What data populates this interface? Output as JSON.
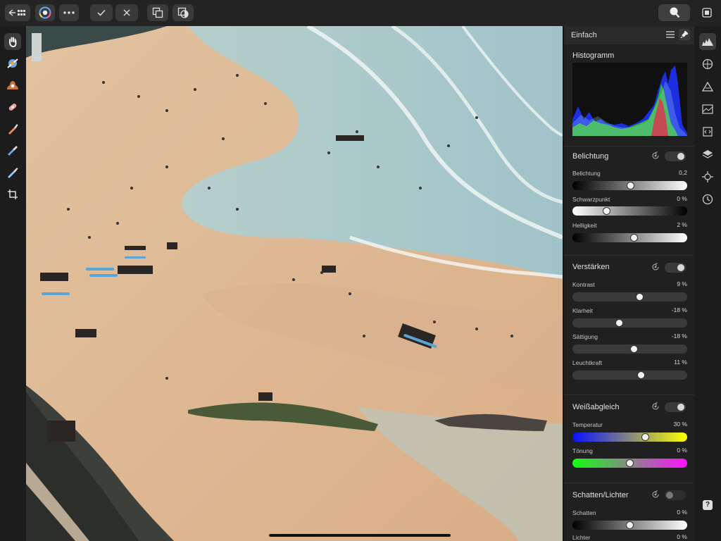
{
  "toolbar": {
    "back_icon": "back-grid-icon",
    "persona_icon": "develop-persona-icon",
    "more_icon": "more-icon",
    "apply_icon": "checkmark-icon",
    "cancel_icon": "close-icon",
    "before_after_icon": "before-after-icon",
    "split_icon": "split-view-icon",
    "zoom_icon": "navigator-zoom-icon",
    "overlay_icon": "overlay-icon"
  },
  "tools": [
    "hand-icon",
    "white-balance-icon",
    "red-eye-icon",
    "blemish-icon",
    "brush-icon",
    "clone-icon",
    "overlay-brush-icon",
    "crop-icon"
  ],
  "panel": {
    "title": "Einfach",
    "histogram_title": "Histogramm",
    "sections": [
      {
        "title": "Belichtung",
        "enabled": true,
        "sliders": [
          {
            "label": "Belichtung",
            "value": "0,2",
            "pos": 0.51,
            "gradient": "dark-light"
          },
          {
            "label": "Schwarzpunkt",
            "value": "0 %",
            "pos": 0.3,
            "gradient": "light-dark"
          },
          {
            "label": "Helligkeit",
            "value": "2 %",
            "pos": 0.54,
            "gradient": "dark-light"
          }
        ]
      },
      {
        "title": "Verstärken",
        "enabled": true,
        "sliders": [
          {
            "label": "Kontrast",
            "value": "9 %",
            "pos": 0.59,
            "gradient": "flat"
          },
          {
            "label": "Klarheit",
            "value": "-18 %",
            "pos": 0.41,
            "gradient": "flat"
          },
          {
            "label": "Sättigung",
            "value": "-18 %",
            "pos": 0.54,
            "gradient": "flat"
          },
          {
            "label": "Leuchtkraft",
            "value": "11 %",
            "pos": 0.6,
            "gradient": "flat"
          }
        ]
      },
      {
        "title": "Weißabgleich",
        "enabled": true,
        "sliders": [
          {
            "label": "Temperatur",
            "value": "30 %",
            "pos": 0.64,
            "gradient": "blue-yellow"
          },
          {
            "label": "Tönung",
            "value": "0 %",
            "pos": 0.5,
            "gradient": "green-magenta"
          }
        ]
      },
      {
        "title": "Schatten/Lichter",
        "enabled": false,
        "sliders": [
          {
            "label": "Schatten",
            "value": "0 %",
            "pos": 0.5,
            "gradient": "dark-light"
          },
          {
            "label": "Lichter",
            "value": "0 %",
            "pos": 0.5,
            "gradient": "dark-light"
          }
        ]
      }
    ]
  },
  "rail": [
    "histogram-icon",
    "lens-icon",
    "tone-curve-icon",
    "gradient-icon",
    "lut-icon",
    "layers-icon",
    "transform-icon",
    "history-icon",
    "help-icon"
  ],
  "help_label": "?",
  "colors": {
    "accent": "#2f8fff",
    "panel": "#202020",
    "sand": "#d9b48c",
    "sea": "#a9c9c9"
  }
}
